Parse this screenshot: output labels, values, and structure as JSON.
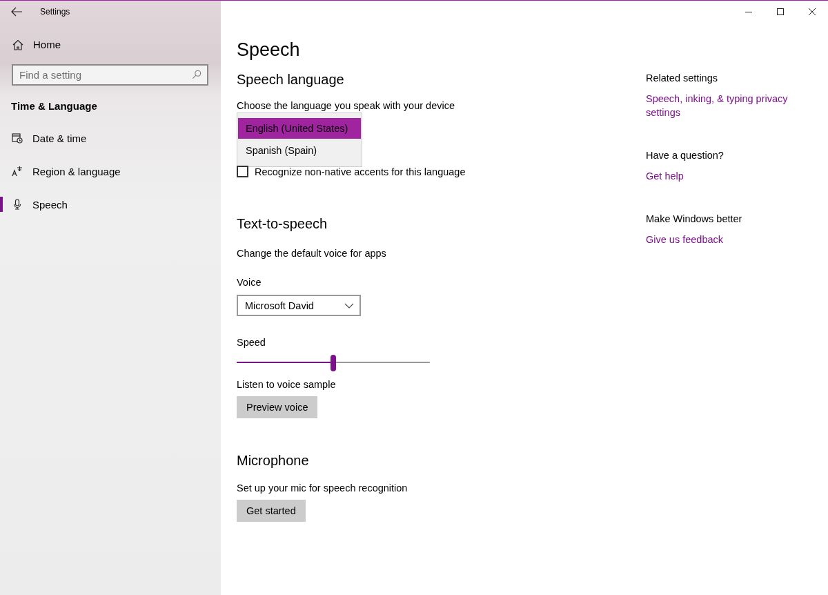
{
  "window": {
    "title": "Settings"
  },
  "sidebar": {
    "home": "Home",
    "search": {
      "placeholder": "Find a setting"
    },
    "section": "Time & Language",
    "items": [
      {
        "label": "Date & time",
        "selected": false
      },
      {
        "label": "Region & language",
        "selected": false
      },
      {
        "label": "Speech",
        "selected": true
      }
    ]
  },
  "page_title": "Speech",
  "speech_language": {
    "heading": "Speech language",
    "description": "Choose the language you speak with your device",
    "options": [
      {
        "label": "English (United States)",
        "selected": true
      },
      {
        "label": "Spanish (Spain)",
        "selected": false
      }
    ],
    "checkbox": {
      "label": "Recognize non-native accents for this language",
      "checked": false
    }
  },
  "text_to_speech": {
    "heading": "Text-to-speech",
    "description": "Change the default voice for apps",
    "voice_label": "Voice",
    "voice_value": "Microsoft David",
    "speed_label": "Speed",
    "speed": {
      "level": 0.5
    },
    "sample_label": "Listen to voice sample",
    "button": "Preview voice"
  },
  "microphone": {
    "heading": "Microphone",
    "description": "Set up your mic for speech recognition",
    "button": "Get started"
  },
  "related": [
    {
      "heading": "Related settings",
      "links": [
        "Speech, inking, & typing privacy settings"
      ]
    },
    {
      "heading": "Have a question?",
      "links": [
        "Get help"
      ]
    },
    {
      "heading": "Make Windows better",
      "links": [
        "Give us feedback"
      ]
    }
  ]
}
